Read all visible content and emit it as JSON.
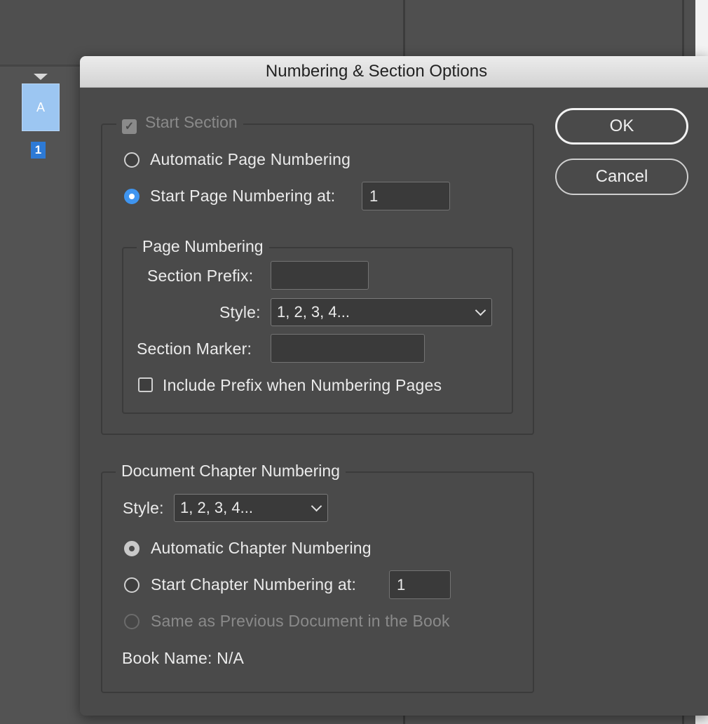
{
  "app": {
    "page_thumb_label": "A",
    "page_number": "1"
  },
  "dialog": {
    "title": "Numbering & Section Options",
    "ok_label": "OK",
    "cancel_label": "Cancel",
    "start_section": {
      "label": "Start Section",
      "checked": true,
      "enabled": false
    },
    "automatic_page_numbering": {
      "label": "Automatic Page Numbering",
      "selected": false
    },
    "start_page_numbering": {
      "label": "Start Page Numbering at:",
      "selected": true,
      "value": "1"
    },
    "page_numbering": {
      "legend": "Page Numbering",
      "section_prefix_label": "Section Prefix:",
      "section_prefix_value": "",
      "style_label": "Style:",
      "style_value": "1, 2, 3, 4...",
      "section_marker_label": "Section Marker:",
      "section_marker_value": "",
      "include_prefix_label": "Include Prefix when Numbering Pages",
      "include_prefix_checked": false
    },
    "chapter_numbering": {
      "legend": "Document Chapter Numbering",
      "style_label": "Style:",
      "style_value": "1, 2, 3, 4...",
      "automatic_label": "Automatic Chapter Numbering",
      "automatic_selected": true,
      "start_label": "Start Chapter Numbering at:",
      "start_value": "1",
      "same_as_previous_label": "Same as Previous Document in the Book",
      "same_as_previous_enabled": false,
      "book_name_label": "Book Name: N/A"
    }
  },
  "colors": {
    "accent": "#3f95f0",
    "dialog_bg": "#4a4a4a",
    "app_bg": "#535353"
  }
}
